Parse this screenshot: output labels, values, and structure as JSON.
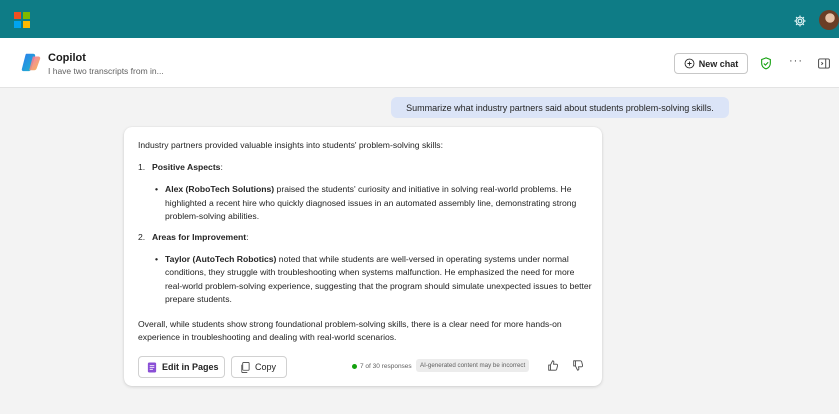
{
  "topbar": {
    "logo_colors": [
      "#f25022",
      "#7fba00",
      "#00a4ef",
      "#ffb900"
    ],
    "icons": [
      "microsoft-logo-icon",
      "gear-icon",
      "avatar"
    ],
    "bg_color": "#0e7c86"
  },
  "header": {
    "title": "Copilot",
    "subtitle": "I have two transcripts from in...",
    "new_chat_label": "New chat",
    "more_label": "···"
  },
  "chat": {
    "user_message": "Summarize what industry partners said about students problem-solving skills.",
    "response": {
      "intro": "Industry partners provided valuable insights into students' problem-solving skills:",
      "sections": [
        {
          "number": "1.",
          "heading": "Positive Aspects",
          "bullet_name": "Alex (RoboTech Solutions)",
          "bullet_text": " praised the students' curiosity and initiative in solving real-world problems. He highlighted a recent hire who quickly diagnosed issues in an automated assembly line, demonstrating strong problem-solving abilities."
        },
        {
          "number": "2.",
          "heading": "Areas for Improvement",
          "bullet_name": "Taylor (AutoTech Robotics)",
          "bullet_text": " noted that while students are well-versed in operating systems under normal conditions, they struggle with troubleshooting when systems malfunction. He emphasized the need for more real-world problem-solving experience, suggesting that the program should simulate unexpected issues to better prepare students."
        }
      ],
      "conclusion": "Overall, while students show strong foundational problem-solving skills, there is a clear need for more hands-on experience in troubleshooting and dealing with real-world scenarios."
    },
    "actions": {
      "edit_label": "Edit in Pages",
      "copy_label": "Copy",
      "responses_text": "7 of 30 responses",
      "ai_disclaimer": "AI-generated content may be incorrect"
    }
  }
}
